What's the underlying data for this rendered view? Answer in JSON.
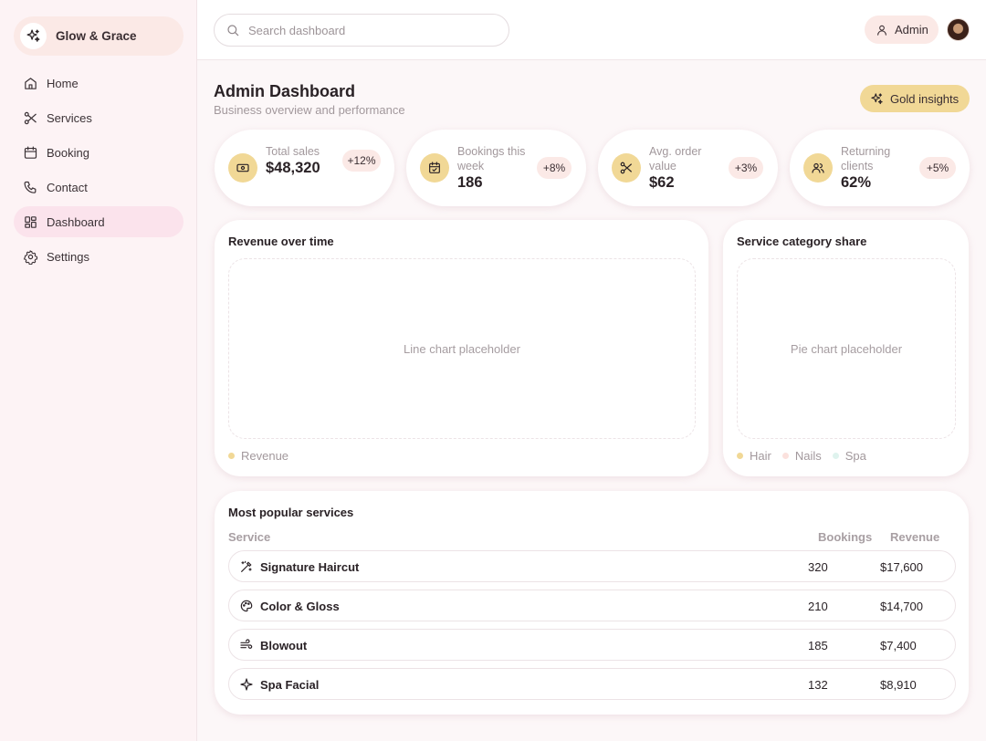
{
  "brand": {
    "name": "Glow & Grace",
    "icon": "sparkle-icon"
  },
  "sidebar": {
    "items": [
      {
        "label": "Home",
        "icon": "home-icon"
      },
      {
        "label": "Services",
        "icon": "scissors-icon"
      },
      {
        "label": "Booking",
        "icon": "calendar-icon"
      },
      {
        "label": "Contact",
        "icon": "phone-icon"
      },
      {
        "label": "Dashboard",
        "icon": "dashboard-icon",
        "active": true
      },
      {
        "label": "Settings",
        "icon": "gear-icon"
      }
    ]
  },
  "header": {
    "search_placeholder": "Search dashboard",
    "admin_label": "Admin"
  },
  "page": {
    "title": "Admin Dashboard",
    "subtitle": "Business overview and performance",
    "insights_label": "Gold insights"
  },
  "stats": [
    {
      "label": "Total sales",
      "value": "$48,320",
      "delta": "+12%",
      "icon": "cash-icon"
    },
    {
      "label": "Bookings this week",
      "value": "186",
      "delta": "+8%",
      "icon": "calendar-check-icon"
    },
    {
      "label": "Avg. order value",
      "value": "$62",
      "delta": "+3%",
      "icon": "scissors-icon"
    },
    {
      "label": "Returning clients",
      "value": "62%",
      "delta": "+5%",
      "icon": "users-icon"
    }
  ],
  "revenue_chart": {
    "title": "Revenue over time",
    "placeholder": "Line chart placeholder",
    "legend": [
      {
        "label": "Revenue",
        "color": "#f1d896"
      }
    ]
  },
  "category_chart": {
    "title": "Service category share",
    "placeholder": "Pie chart placeholder",
    "legend": [
      {
        "label": "Hair",
        "color": "#f1d896"
      },
      {
        "label": "Nails",
        "color": "#fbe1dd"
      },
      {
        "label": "Spa",
        "color": "#dff3ee"
      }
    ]
  },
  "popular": {
    "title": "Most popular services",
    "columns": [
      "Service",
      "Bookings",
      "Revenue"
    ],
    "rows": [
      {
        "service": "Signature Haircut",
        "bookings": "320",
        "revenue": "$17,600",
        "icon": "magic-wand-icon"
      },
      {
        "service": "Color & Gloss",
        "bookings": "210",
        "revenue": "$14,700",
        "icon": "palette-icon"
      },
      {
        "service": "Blowout",
        "bookings": "185",
        "revenue": "$7,400",
        "icon": "wind-icon"
      },
      {
        "service": "Spa Facial",
        "bookings": "132",
        "revenue": "$8,910",
        "icon": "sparkle-icon"
      }
    ]
  },
  "colors": {
    "accent_gold": "#f1d896",
    "accent_pink": "#fbe9e6",
    "active_nav": "#fbe3ec"
  }
}
